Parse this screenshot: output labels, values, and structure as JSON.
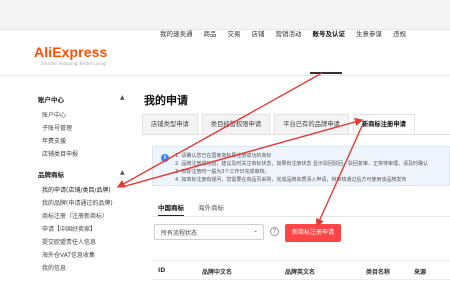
{
  "brand": {
    "name": "AliExpress",
    "tagline": "Smarter Shopping, Better Living!"
  },
  "nav": {
    "items": [
      "我的速卖通",
      "商品",
      "交易",
      "店铺",
      "营销活动",
      "账号及认证",
      "生意参谋",
      "违规"
    ],
    "active_index": 5
  },
  "sidebar": {
    "sections": [
      {
        "title": "账户中心",
        "items": [
          "账户中心",
          "子账号管理",
          "年费支援",
          "店铺类目申报"
        ]
      },
      {
        "title": "品牌商标",
        "items": [
          "我的申请(店铺/类目/品牌)",
          "我的品牌(申请通过的品牌)",
          "商标注册（注册新商标）",
          "申请【中国好卖家】",
          "提交欧盟责任人信息",
          "海外仓VAT信息收集",
          "我的信息"
        ]
      }
    ]
  },
  "main": {
    "title": "我的申请",
    "tabs": [
      "店铺类型申请",
      "类目经营权限申请",
      "平台已有的品牌申请",
      "新商标注册申请"
    ],
    "active_tab": 3,
    "notice_lines": [
      "1. 请确认您已在国家商标局注册成功的商标",
      "2. 品牌注册成功后，建议及时关注商标状态，如果有注册状态 显示驳回驳回，驳回复审，正常待审理，请及时确认",
      "3. 商标注册时一般为3个工作日完成审核。",
      "4. 如商标注册有疑问，您需要在商品页采购，完成品牌资质添入申请，待审核通过后方可使用该品牌发布"
    ],
    "subtabs": [
      "中国商标",
      "海外商标"
    ],
    "active_subtab": 0,
    "filter": {
      "selected": "所有流程状态"
    },
    "primary_button": "新商标注册申请",
    "table_headers": [
      "ID",
      "品牌中文名",
      "品牌英文名",
      "类目名称",
      "来源"
    ]
  },
  "colors": {
    "accent": "#ff4d00",
    "button": "#ff4646",
    "arrow": "#e53935",
    "notice_bg": "#eef5fd"
  },
  "icons": [
    "chevron-up-icon",
    "info-icon",
    "help-icon",
    "chevron-down-icon"
  ]
}
